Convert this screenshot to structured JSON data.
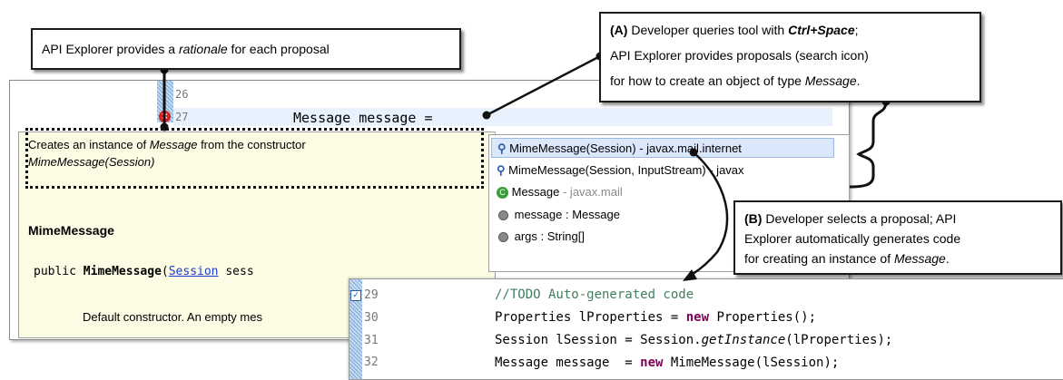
{
  "callouts": {
    "rationale": {
      "pre": "API Explorer provides a ",
      "em": "rationale",
      "post": " for each proposal"
    },
    "a": {
      "label": "(A)",
      "l1_pre": " Developer queries tool with ",
      "l1_key": "Ctrl+Space",
      "l1_post": ";",
      "l2": "API Explorer provides proposals (search icon)",
      "l3_pre": "for how to create an object of type ",
      "l3_em": "Message",
      "l3_post": "."
    },
    "b": {
      "label": "(B)",
      "l1": " Developer selects a proposal; API",
      "l2": "Explorer automatically generates code",
      "l3_pre": "for creating an instance of ",
      "l3_em": "Message",
      "l3_post": "."
    }
  },
  "editor": {
    "line_numbers": [
      "26",
      "27"
    ],
    "line27_code": "Message message ="
  },
  "tooltip": {
    "line1_pre": "Creates an instance of ",
    "line1_em": "Message",
    "line1_post": " from the constructor",
    "line2_em": "MimeMessage(Session)",
    "heading": "MimeMessage",
    "sig_pre": "public ",
    "sig_name": "MimeMessage",
    "sig_paren": "(",
    "sig_link": "Session",
    "sig_post": " sess",
    "desc": "Default constructor. An empty mes"
  },
  "proposals": [
    {
      "icon": "search-icon",
      "text": "MimeMessage(Session)",
      "pkg": " - javax.mail.internet",
      "selected": true
    },
    {
      "icon": "search-icon",
      "text": "MimeMessage(Session, InputStream) - javax",
      "pkg": "",
      "selected": false
    },
    {
      "icon": "class-icon",
      "text": "Message",
      "pkg": " - javax.mail",
      "selected": false
    },
    {
      "icon": "field-icon",
      "text": "message : Message",
      "pkg": "",
      "selected": false
    },
    {
      "icon": "field-icon",
      "text": "args : String[]",
      "pkg": "",
      "selected": false
    }
  ],
  "generated": {
    "line_numbers": [
      "29",
      "30",
      "31",
      "32"
    ],
    "l29": "//TODO Auto-generated code",
    "l30_a": "Properties lProperties = ",
    "l30_kw": "new",
    "l30_b": " Properties();",
    "l31_a": "Session lSession = Session.",
    "l31_it": "getInstance",
    "l31_b": "(lProperties);",
    "l32_a": "Message message  = ",
    "l32_kw": "new",
    "l32_b": " MimeMessage(lSession);"
  },
  "colors": {
    "keyword": "#7f0055",
    "comment": "#3f7f5f",
    "selection": "#dbe8fb",
    "tooltip_bg": "#fcfbe4",
    "error": "#d81e1e"
  }
}
